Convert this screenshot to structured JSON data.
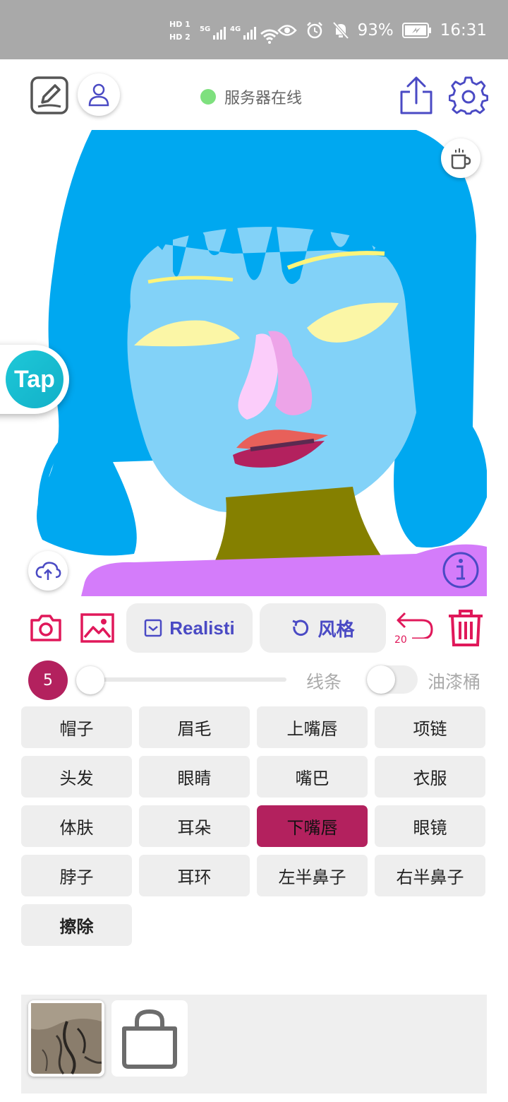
{
  "status_bar": {
    "sim1": "HD 1",
    "sim2": "HD 2",
    "net1": "5G",
    "net2": "4G",
    "battery": "93%",
    "time": "16:31"
  },
  "header": {
    "server_status": "服务器在线",
    "server_status_color": "#7ee07e"
  },
  "tools": {
    "style_button_label": "Realisti",
    "restyle_button_label": "风格",
    "undo_count": "20",
    "accent_color": "#e0185a",
    "purple_color": "#4a4ac4"
  },
  "brush": {
    "size": "5",
    "size_fraction": 0,
    "line_label": "线条",
    "bucket_label": "油漆桶",
    "bucket_on": false
  },
  "parts": [
    {
      "label": "帽子",
      "active": false
    },
    {
      "label": "眉毛",
      "active": false
    },
    {
      "label": "上嘴唇",
      "active": false
    },
    {
      "label": "项链",
      "active": false
    },
    {
      "label": "头发",
      "active": false
    },
    {
      "label": "眼睛",
      "active": false
    },
    {
      "label": "嘴巴",
      "active": false
    },
    {
      "label": "衣服",
      "active": false
    },
    {
      "label": "体肤",
      "active": false
    },
    {
      "label": "耳朵",
      "active": false
    },
    {
      "label": "下嘴唇",
      "active": true
    },
    {
      "label": "眼镜",
      "active": false
    },
    {
      "label": "脖子",
      "active": false
    },
    {
      "label": "耳环",
      "active": false
    },
    {
      "label": "左半鼻子",
      "active": false
    },
    {
      "label": "右半鼻子",
      "active": false
    },
    {
      "label": "擦除",
      "active": false
    }
  ],
  "active_color": "#b3215e",
  "floating": {
    "tap_label": "Tap"
  }
}
